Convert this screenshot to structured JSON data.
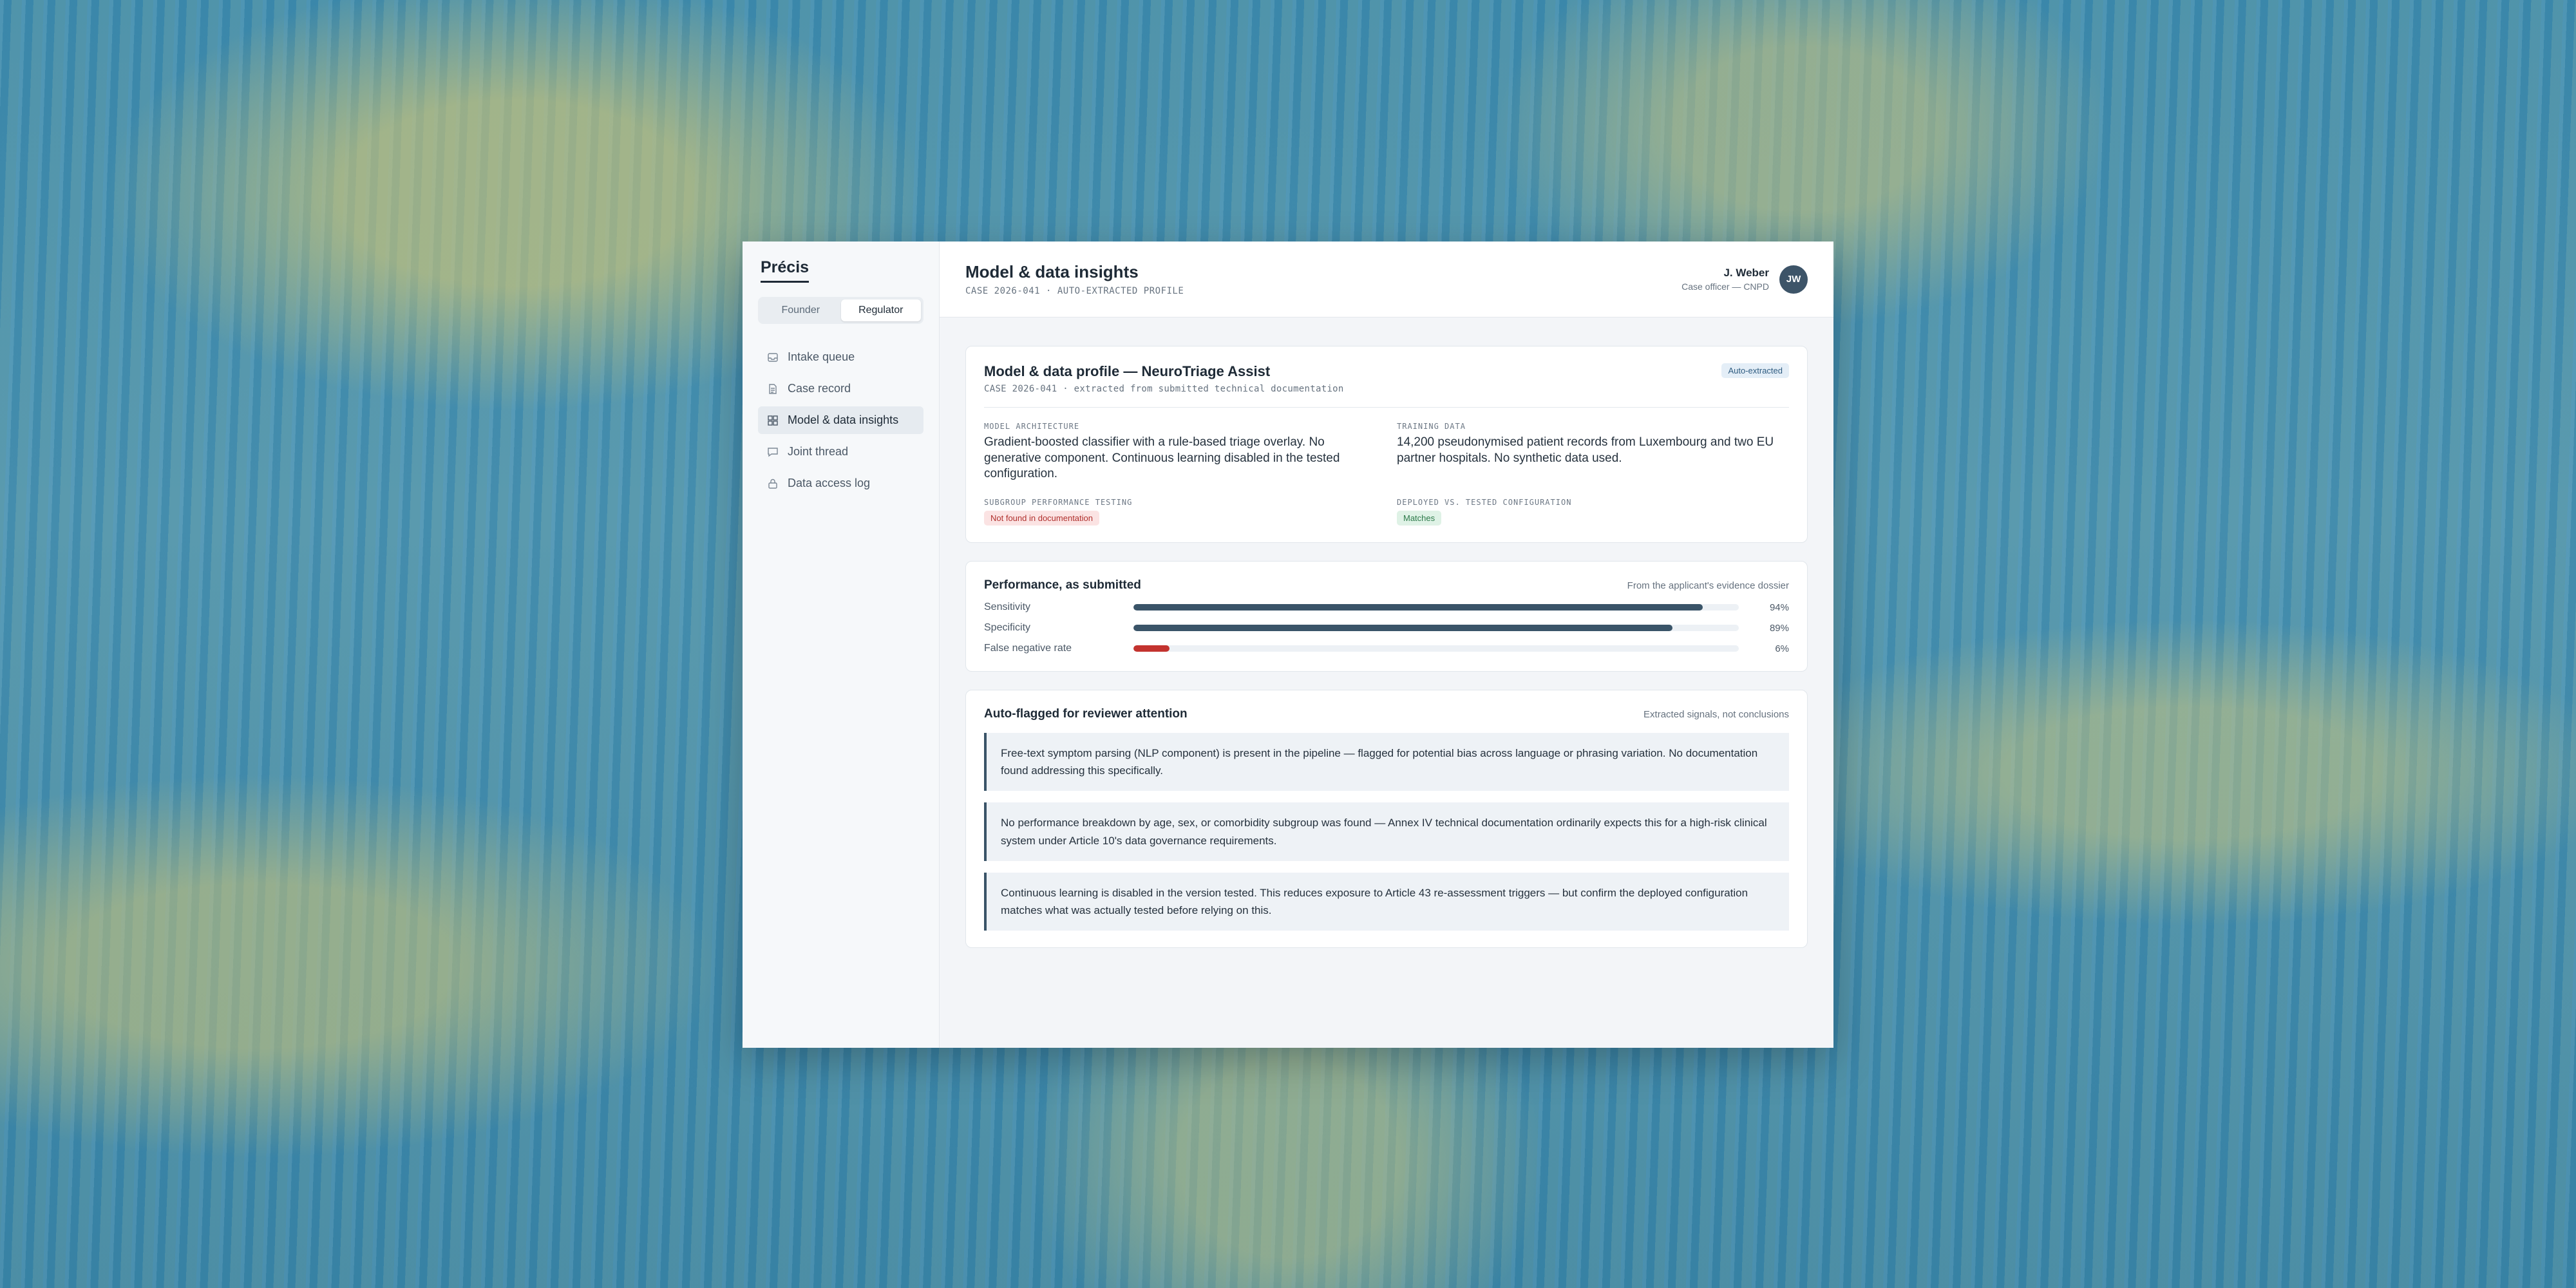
{
  "sidebar": {
    "brand": "Précis",
    "roles": [
      "Founder",
      "Regulator"
    ],
    "active_role": "Regulator",
    "items": [
      {
        "label": "Intake queue",
        "icon": "inbox-icon"
      },
      {
        "label": "Case record",
        "icon": "document-icon"
      },
      {
        "label": "Model & data insights",
        "icon": "grid-icon",
        "active": true
      },
      {
        "label": "Joint thread",
        "icon": "chat-icon"
      },
      {
        "label": "Data access log",
        "icon": "lock-icon"
      }
    ]
  },
  "header": {
    "title": "Model & data insights",
    "subtitle": "CASE 2026-041 · AUTO-EXTRACTED PROFILE",
    "user_name": "J. Weber",
    "user_role": "Case officer — CNPD",
    "avatar_initials": "JW"
  },
  "profile": {
    "title": "Model & data profile — NeuroTriage Assist",
    "subtitle": "CASE 2026-041 · extracted from submitted technical documentation",
    "badge": "Auto-extracted",
    "model_architecture_label": "MODEL ARCHITECTURE",
    "model_architecture": "Gradient-boosted classifier with a rule-based triage overlay. No generative component. Continuous learning disabled in the tested configuration.",
    "training_data_label": "TRAINING DATA",
    "training_data": "14,200 pseudonymised patient records from Luxembourg and two EU partner hospitals. No synthetic data used.",
    "subgroup_label": "SUBGROUP PERFORMANCE TESTING",
    "subgroup_status": "Not found in documentation",
    "deployed_label": "DEPLOYED VS. TESTED CONFIGURATION",
    "deployed_status": "Matches"
  },
  "performance": {
    "title": "Performance, as submitted",
    "note": "From the applicant's evidence dossier",
    "metrics": [
      {
        "label": "Sensitivity",
        "value": 94,
        "display": "94%"
      },
      {
        "label": "Specificity",
        "value": 89,
        "display": "89%"
      },
      {
        "label": "False negative rate",
        "value": 6,
        "display": "6%",
        "alert": true
      }
    ]
  },
  "flags": {
    "title": "Auto-flagged for reviewer attention",
    "note": "Extracted signals, not conclusions",
    "items": [
      "Free-text symptom parsing (NLP component) is present in the pipeline — flagged for potential bias across language or phrasing variation. No documentation found addressing this specifically.",
      "No performance breakdown by age, sex, or comorbidity subgroup was found — Annex IV technical documentation ordinarily expects this for a high-risk clinical system under Article 10's data governance requirements.",
      "Continuous learning is disabled in the version tested. This reduces exposure to Article 43 re-assessment triggers — but confirm the deployed configuration matches what was actually tested before relying on this."
    ]
  },
  "colors": {
    "bar": "#3a5468",
    "bar_alert": "#c3332f",
    "accent": "#3a5468"
  }
}
